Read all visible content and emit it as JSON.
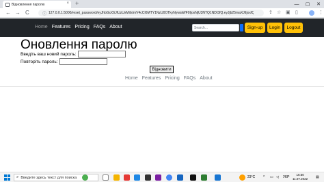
{
  "browser": {
    "tab_title": "Відновлення паролю",
    "tab_close": "×",
    "new_tab": "+",
    "window_controls": {
      "minimize": "—",
      "maximize": "▢",
      "close": "✕"
    },
    "nav_back": "←",
    "nav_forward": "→",
    "nav_reload": "C",
    "url": "127.0.0.1:5000/reset_password/eyJhbGciOiJIUzUxMiIsImV4cCI6MTY1NzU0OTkyNywiaWF0IjoxNjU3NTQ1NDI3fQ.eyJjb25maXJtIjoxfQ.jpoSt...",
    "url_lock": "ⓘ"
  },
  "navbar": {
    "links": [
      {
        "label": "Home",
        "active": true
      },
      {
        "label": "Features",
        "active": false
      },
      {
        "label": "Pricing",
        "active": false
      },
      {
        "label": "FAQs",
        "active": false
      },
      {
        "label": "About",
        "active": false
      }
    ],
    "search_placeholder": "Search...",
    "signup_label": "Sign-up",
    "login_label": "Login",
    "logout_label": "Logout",
    "accent_color": "#ffc107",
    "bg_color": "#212529"
  },
  "page": {
    "title": "Оновлення паролю",
    "new_password_label": "Введіть ваш новий пароль:",
    "repeat_password_label": "Повторіть пароль:",
    "submit_label": "Відновити"
  },
  "footer": {
    "links": [
      "Home",
      "Features",
      "Pricing",
      "FAQs",
      "About"
    ]
  },
  "taskbar": {
    "search_placeholder": "Введите здесь текст для поиска",
    "weather": "23°C",
    "language": "УКР",
    "time": "16:50",
    "date": "11.07.2022"
  }
}
